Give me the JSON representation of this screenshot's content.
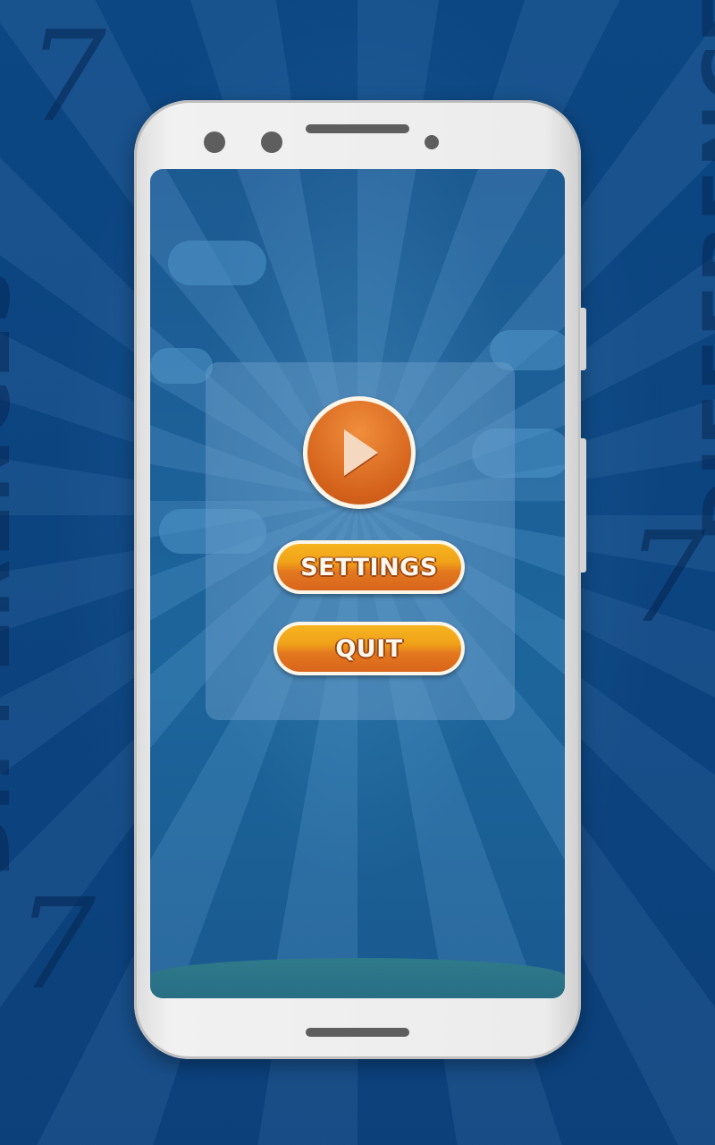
{
  "background": {
    "title_word": "DIFFERENCES",
    "title_number": "7",
    "color": "#0f4a86"
  },
  "menu": {
    "play_icon": "play-icon",
    "settings_label": "SETTINGS",
    "quit_label": "QUIT",
    "accent_color": "#e3781f"
  }
}
